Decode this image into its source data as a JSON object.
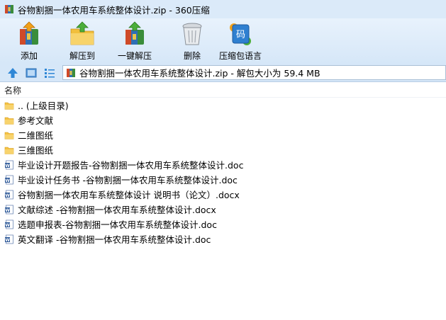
{
  "window": {
    "title": "谷物割捆一体农用车系统整体设计.zip - 360压缩",
    "app_icon": "archive-icon"
  },
  "toolbar": {
    "buttons": [
      {
        "label": "添加",
        "icon": "add-archive-icon"
      },
      {
        "label": "解压到",
        "icon": "extract-to-folder-icon"
      },
      {
        "label": "一键解压",
        "icon": "one-click-extract-icon"
      },
      {
        "label": "删除",
        "icon": "trash-icon"
      },
      {
        "label": "压缩包语言",
        "icon": "archive-language-icon"
      }
    ],
    "language_badge": "码"
  },
  "address": {
    "path": "谷物割捆一体农用车系统整体设计.zip - 解包大小为 59.4 MB",
    "nav_icons": [
      "up-arrow-icon",
      "large-icon-view-icon",
      "list-view-icon"
    ]
  },
  "list": {
    "column_header": "名称",
    "items": [
      {
        "name": ".. (上级目录)",
        "type": "folder"
      },
      {
        "name": "参考文献",
        "type": "folder"
      },
      {
        "name": "二维图纸",
        "type": "folder"
      },
      {
        "name": "三维图纸",
        "type": "folder"
      },
      {
        "name": "毕业设计开题报告-谷物割捆一体农用车系统整体设计.doc",
        "type": "word"
      },
      {
        "name": "毕业设计任务书 -谷物割捆一体农用车系统整体设计.doc",
        "type": "word"
      },
      {
        "name": "谷物割捆一体农用车系统整体设计 说明书（论文）.docx",
        "type": "word"
      },
      {
        "name": "文献综述 -谷物割捆一体农用车系统整体设计.docx",
        "type": "word"
      },
      {
        "name": "选题申报表-谷物割捆一体农用车系统整体设计.doc",
        "type": "word"
      },
      {
        "name": "英文翻译 -谷物割捆一体农用车系统整体设计.doc",
        "type": "word"
      }
    ]
  },
  "colors": {
    "titlebar_bg": "#dbeaf9",
    "toolbar_bg": "#d6e7f8",
    "folder": "#f5c244",
    "word_icon": "#2b5797"
  }
}
